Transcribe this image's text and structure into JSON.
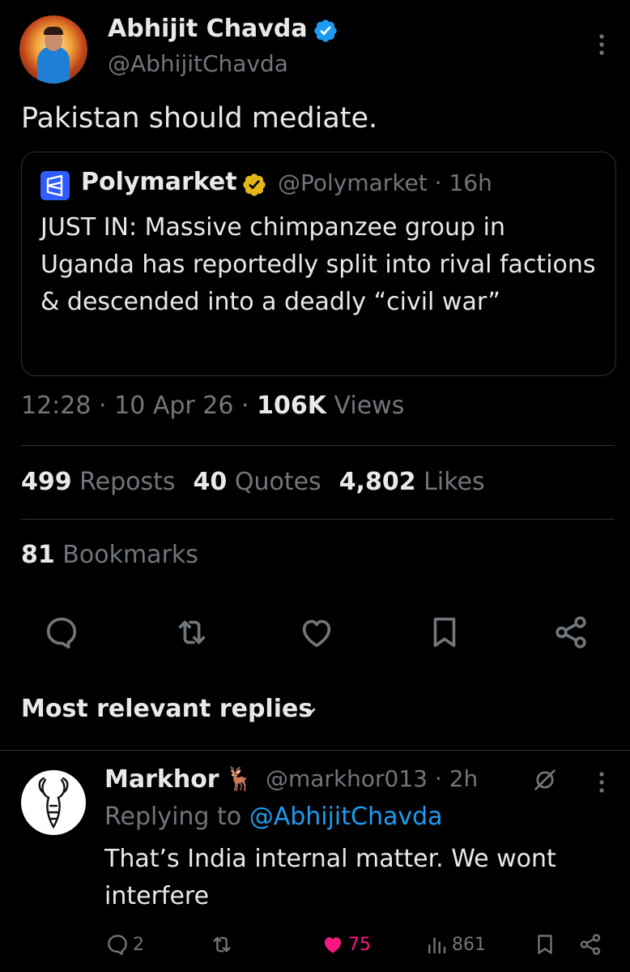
{
  "tweet": {
    "author_name": "Abhijit Chavda",
    "author_handle": "@AbhijitChavda",
    "text": "Pakistan should mediate.",
    "quote": {
      "author_name": "Polymarket",
      "author_handle": "@Polymarket",
      "separator": "·",
      "time": "16h",
      "text": "JUST IN: Massive chimpanzee group in Uganda has reportedly split into rival factions & descended into a deadly “civil war”"
    },
    "time": "12:28",
    "date": "10 Apr 26",
    "views_count": "106K",
    "views_label": "Views",
    "reposts_count": "499",
    "reposts_label": "Reposts",
    "quotes_count": "40",
    "quotes_label": "Quotes",
    "likes_count": "4,802",
    "likes_label": "Likes",
    "bookmarks_count": "81",
    "bookmarks_label": "Bookmarks",
    "actions": [
      "reply-icon",
      "repost-icon",
      "like-icon",
      "bookmark-icon",
      "share-icon"
    ]
  },
  "replies_section": {
    "sort_label": "Most relevant replies"
  },
  "reply": {
    "author_name": "Markhor",
    "emoji": "🦌",
    "author_handle": "@markhor013",
    "time": "2h",
    "replying_prefix": "Replying to",
    "replying_to": "@AbhijitChavda",
    "text": "That’s India internal matter. We wont interfere",
    "reply_count": "2",
    "like_count": "75",
    "view_count": "861"
  },
  "colors": {
    "background": "#000000",
    "text": "#e7e9ea",
    "muted": "#71767b",
    "link": "#1d9bf0",
    "like": "#f91880",
    "verified_blue": "#1d9bf0",
    "verified_gold": "#e2b719"
  }
}
